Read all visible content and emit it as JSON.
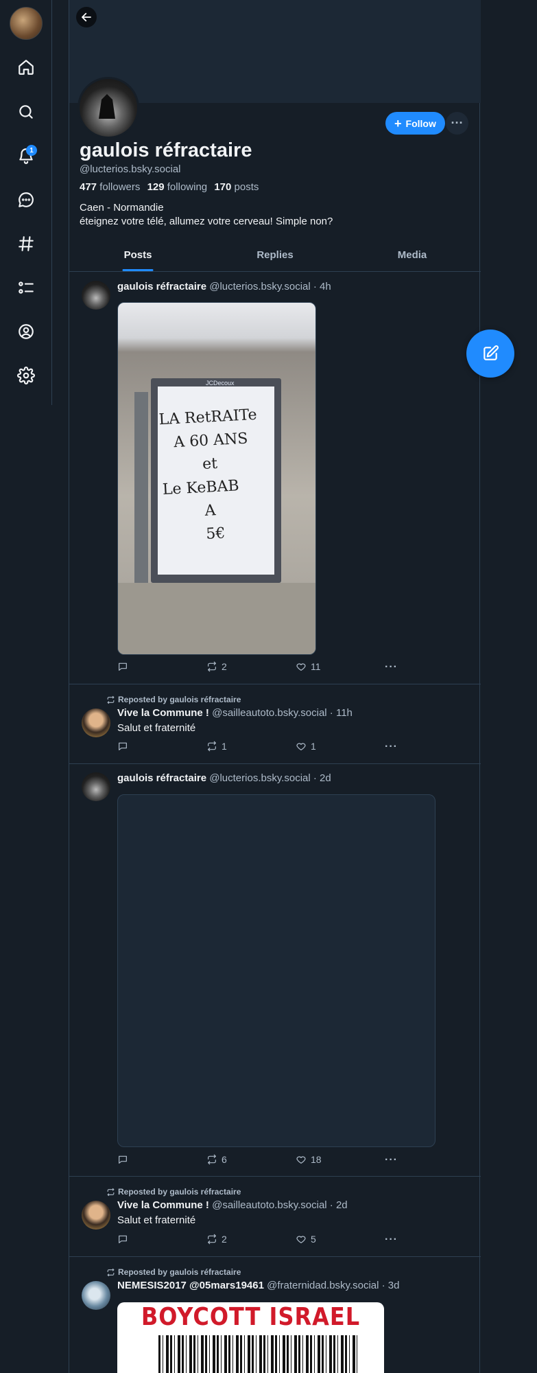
{
  "profile": {
    "display_name": "gaulois réfractaire",
    "handle": "@lucterios.bsky.social",
    "followers_count": "477",
    "followers_label": "followers",
    "following_count": "129",
    "following_label": "following",
    "posts_count": "170",
    "posts_label": "posts",
    "bio_line1": "Caen - Normandie",
    "bio_line2": "éteignez votre télé, allumez votre cerveau! Simple non?",
    "follow_label": "Follow",
    "more_label": "···"
  },
  "nav": {
    "notification_badge": "1",
    "icons": [
      "home-icon",
      "search-icon",
      "bell-icon",
      "chat-icon",
      "hashtag-icon",
      "list-icon",
      "profile-icon",
      "gear-icon"
    ]
  },
  "tabs": [
    "Posts",
    "Replies",
    "Media"
  ],
  "posts": [
    {
      "author": "gaulois réfractaire",
      "meta": "@lucterios.bsky.social · 4h",
      "image_text": [
        "LA RetRAITe",
        "A 60 ANS",
        "et",
        "Le KeBAB",
        "A",
        "5€"
      ],
      "image_brand": "JCDecoux",
      "reposts": "2",
      "likes": "11"
    },
    {
      "repost_by": "Reposted by gaulois réfractaire",
      "author": "Vive la Commune !",
      "meta": "@sailleautoto.bsky.social · 11h",
      "text": "Salut et fraternité",
      "reposts": "1",
      "likes": "1"
    },
    {
      "author": "gaulois réfractaire",
      "meta": "@lucterios.bsky.social · 2d",
      "reposts": "6",
      "likes": "18"
    },
    {
      "repost_by": "Reposted by gaulois réfractaire",
      "author": "Vive la Commune !",
      "meta": "@sailleautoto.bsky.social · 2d",
      "text": "Salut et fraternité",
      "reposts": "2",
      "likes": "5"
    },
    {
      "repost_by": "Reposted by gaulois réfractaire",
      "author": "NEMESIS2017 @05mars19461",
      "meta": "@fraternidad.bsky.social · 3d",
      "image_text": "BOYCOTT ISRAEL"
    }
  ],
  "colors": {
    "accent": "#208bfe",
    "background": "#161e27",
    "border": "#2e4052",
    "muted_text": "#aebbc9"
  }
}
